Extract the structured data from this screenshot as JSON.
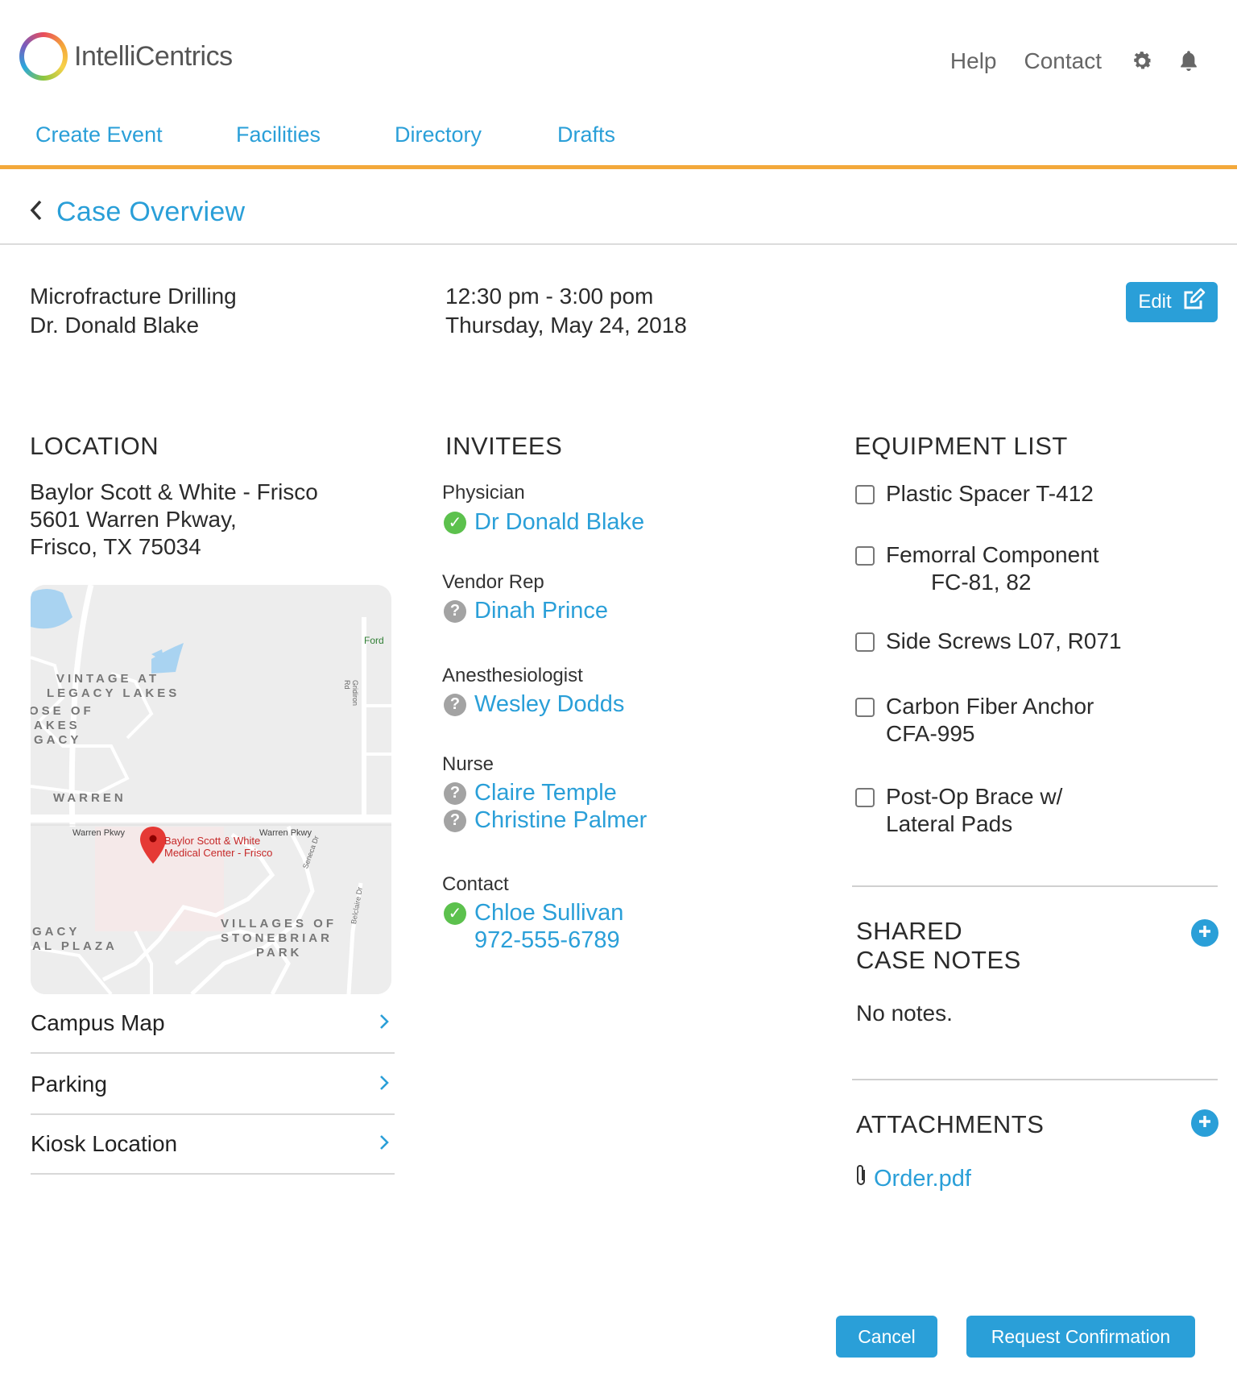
{
  "app": {
    "brand": "IntelliCentrics"
  },
  "header": {
    "links": [
      "Help",
      "Contact"
    ],
    "icons": [
      "gear-icon",
      "bell-icon"
    ]
  },
  "nav": {
    "items": [
      "Create Event",
      "Facilities",
      "Directory",
      "Drafts"
    ]
  },
  "page": {
    "title": "Case Overview"
  },
  "event": {
    "procedure": "Microfracture Drilling",
    "doctor": "Dr. Donald Blake",
    "time": "12:30 pm - 3:00 pom",
    "date": "Thursday, May 24, 2018",
    "edit_label": "Edit"
  },
  "location": {
    "heading": "LOCATION",
    "name": "Baylor Scott & White - Frisco",
    "street": "5601 Warren Pkway,",
    "city": "Frisco, TX 75034",
    "map_labels": {
      "pin": "Baylor Scott & White",
      "pin2": "Medical Center - Frisco",
      "road1": "Warren Pkwy",
      "road2": "Warren Pkwy",
      "area1": "VINTAGE AT",
      "area2": "LEGACY LAKES",
      "area3": "OSE OF",
      "area4": "AKES",
      "area5": "GACY",
      "warren": "WARREN",
      "villages1": "VILLAGES OF",
      "villages2": "STONEBRIAR",
      "villages3": "PARK",
      "legacy1": "GACY",
      "legacy2": "AL PLAZA",
      "ford": "Ford",
      "gridiron": "Gridiron Rd",
      "seneca": "Seneca Dr",
      "belclaire": "Belclaire Dr"
    },
    "links": [
      "Campus Map",
      "Parking",
      "Kiosk Location"
    ]
  },
  "invitees": {
    "heading": "INVITEES",
    "groups": [
      {
        "role": "Physician",
        "people": [
          {
            "name": "Dr Donald Blake",
            "status": "confirmed"
          }
        ]
      },
      {
        "role": "Vendor Rep",
        "people": [
          {
            "name": "Dinah Prince",
            "status": "pending"
          }
        ]
      },
      {
        "role": "Anesthesiologist",
        "people": [
          {
            "name": "Wesley Dodds",
            "status": "pending"
          }
        ]
      },
      {
        "role": "Nurse",
        "people": [
          {
            "name": "Claire Temple",
            "status": "pending"
          },
          {
            "name": "Christine Palmer",
            "status": "pending"
          }
        ]
      },
      {
        "role": "Contact",
        "people": [
          {
            "name": "Chloe Sullivan",
            "status": "confirmed",
            "phone": "972-555-6789"
          }
        ]
      }
    ]
  },
  "equipment": {
    "heading": "EQUIPMENT LIST",
    "items": [
      {
        "line1": "Plastic Spacer T-412",
        "line2": ""
      },
      {
        "line1": "Femorral Component",
        "line2": "FC-81, 82"
      },
      {
        "line1": "Side Screws L07, R071",
        "line2": ""
      },
      {
        "line1": "Carbon Fiber Anchor",
        "line2": "CFA-995"
      },
      {
        "line1": "Post-Op Brace w/",
        "line2": "Lateral Pads"
      }
    ]
  },
  "notes": {
    "heading1": "SHARED",
    "heading2": "CASE NOTES",
    "empty": "No notes."
  },
  "attachments": {
    "heading": "ATTACHMENTS",
    "files": [
      "Order.pdf"
    ]
  },
  "actions": {
    "cancel": "Cancel",
    "confirm": "Request Confirmation"
  },
  "colors": {
    "accent": "#2a9fd8",
    "nav_underline": "#f3a93b",
    "confirmed": "#5cc14d",
    "pending": "#a3a3a3"
  }
}
